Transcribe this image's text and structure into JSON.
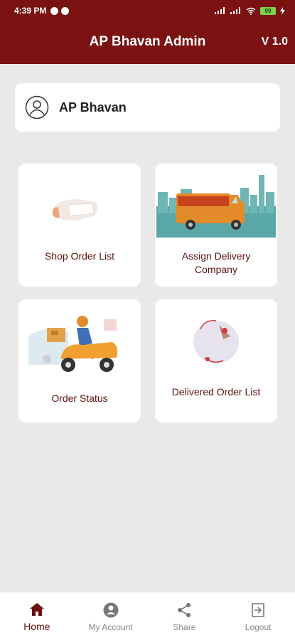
{
  "status_bar": {
    "time": "4:39 PM",
    "battery": "99"
  },
  "app_bar": {
    "title": "AP Bhavan Admin",
    "version": "V 1.0"
  },
  "profile": {
    "name": "AP Bhavan"
  },
  "tiles": [
    {
      "label": "Shop Order List"
    },
    {
      "label": "Assign Delivery Company"
    },
    {
      "label": "Order Status"
    },
    {
      "label": "Delivered Order List"
    }
  ],
  "bottom_nav": [
    {
      "label": "Home",
      "icon": "home-icon",
      "active": true
    },
    {
      "label": "My Account",
      "icon": "account-icon",
      "active": false
    },
    {
      "label": "Share",
      "icon": "share-icon",
      "active": false
    },
    {
      "label": "Logout",
      "icon": "logout-icon",
      "active": false
    }
  ],
  "colors": {
    "primary": "#7a1212",
    "accent_text": "#5a1010",
    "background": "#e9e9e9"
  }
}
